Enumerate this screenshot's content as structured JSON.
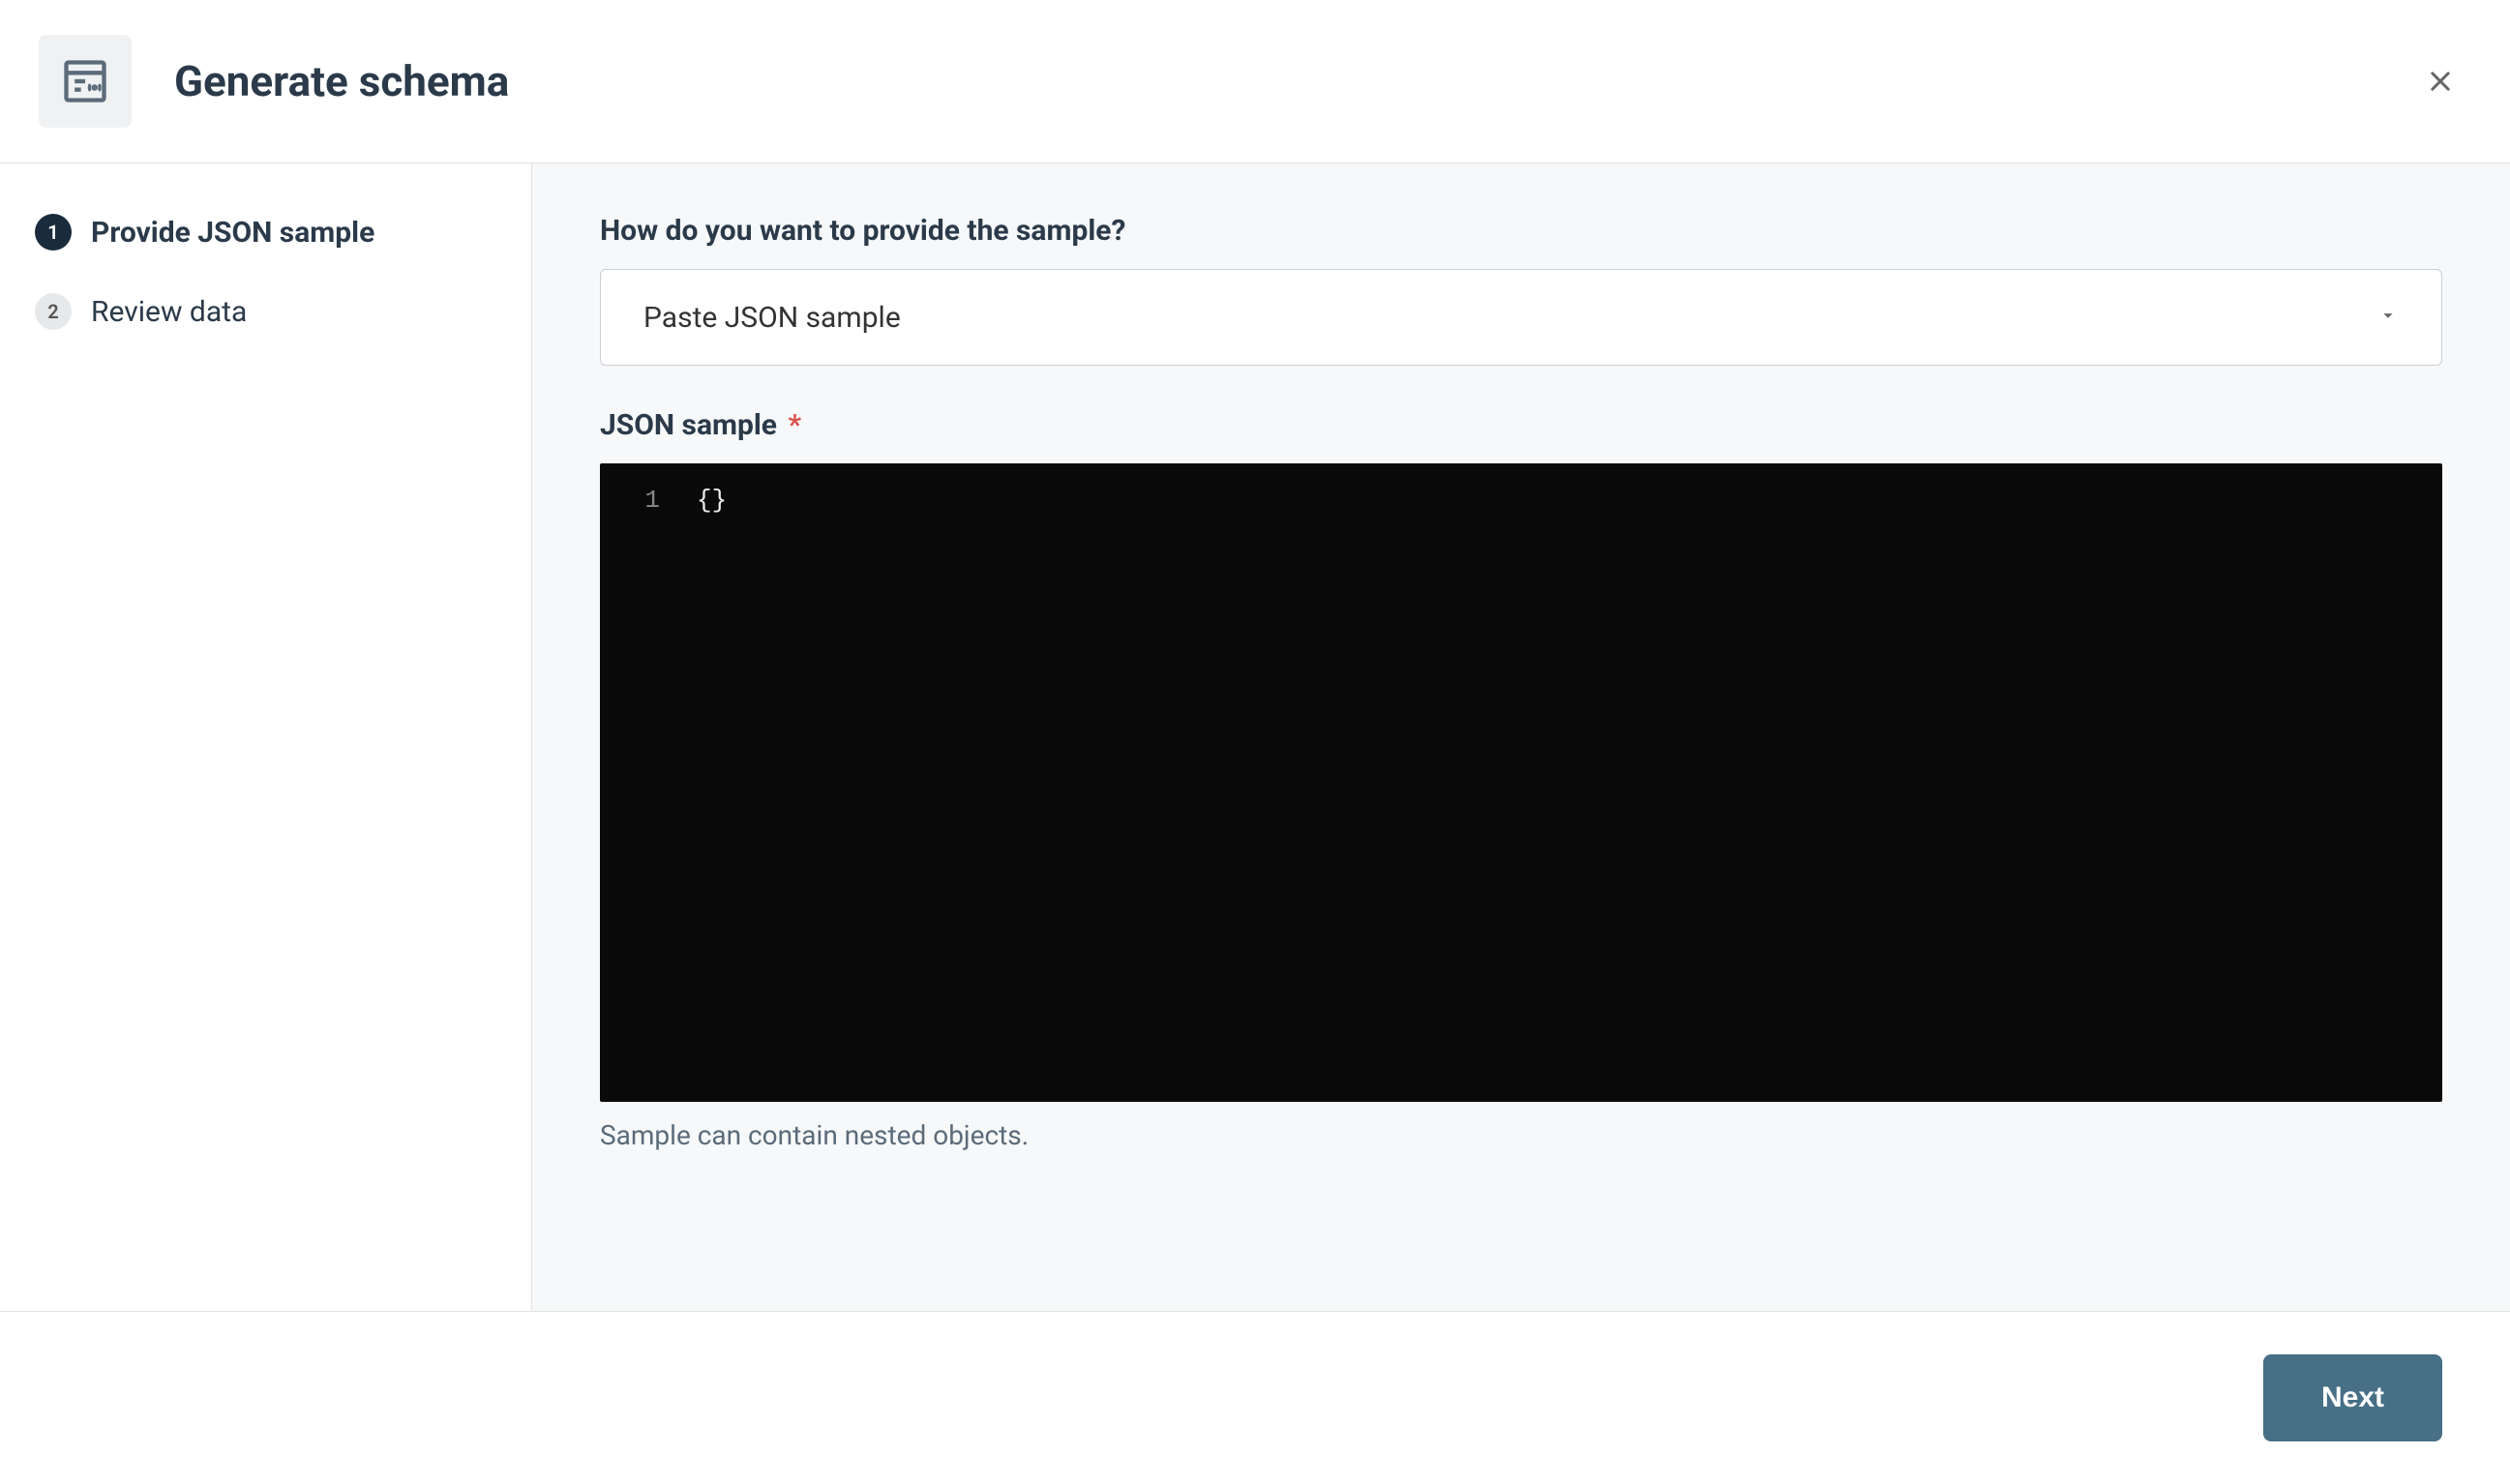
{
  "header": {
    "title": "Generate schema"
  },
  "sidebar": {
    "steps": [
      {
        "number": "1",
        "label": "Provide JSON sample",
        "active": true
      },
      {
        "number": "2",
        "label": "Review data",
        "active": false
      }
    ]
  },
  "main": {
    "sample_method_label": "How do you want to provide the sample?",
    "sample_method_value": "Paste JSON sample",
    "json_sample_label": "JSON sample",
    "json_sample_required": "*",
    "editor": {
      "line_number": "1",
      "content": "{}"
    },
    "helper_text": "Sample can contain nested objects."
  },
  "footer": {
    "next_label": "Next"
  }
}
